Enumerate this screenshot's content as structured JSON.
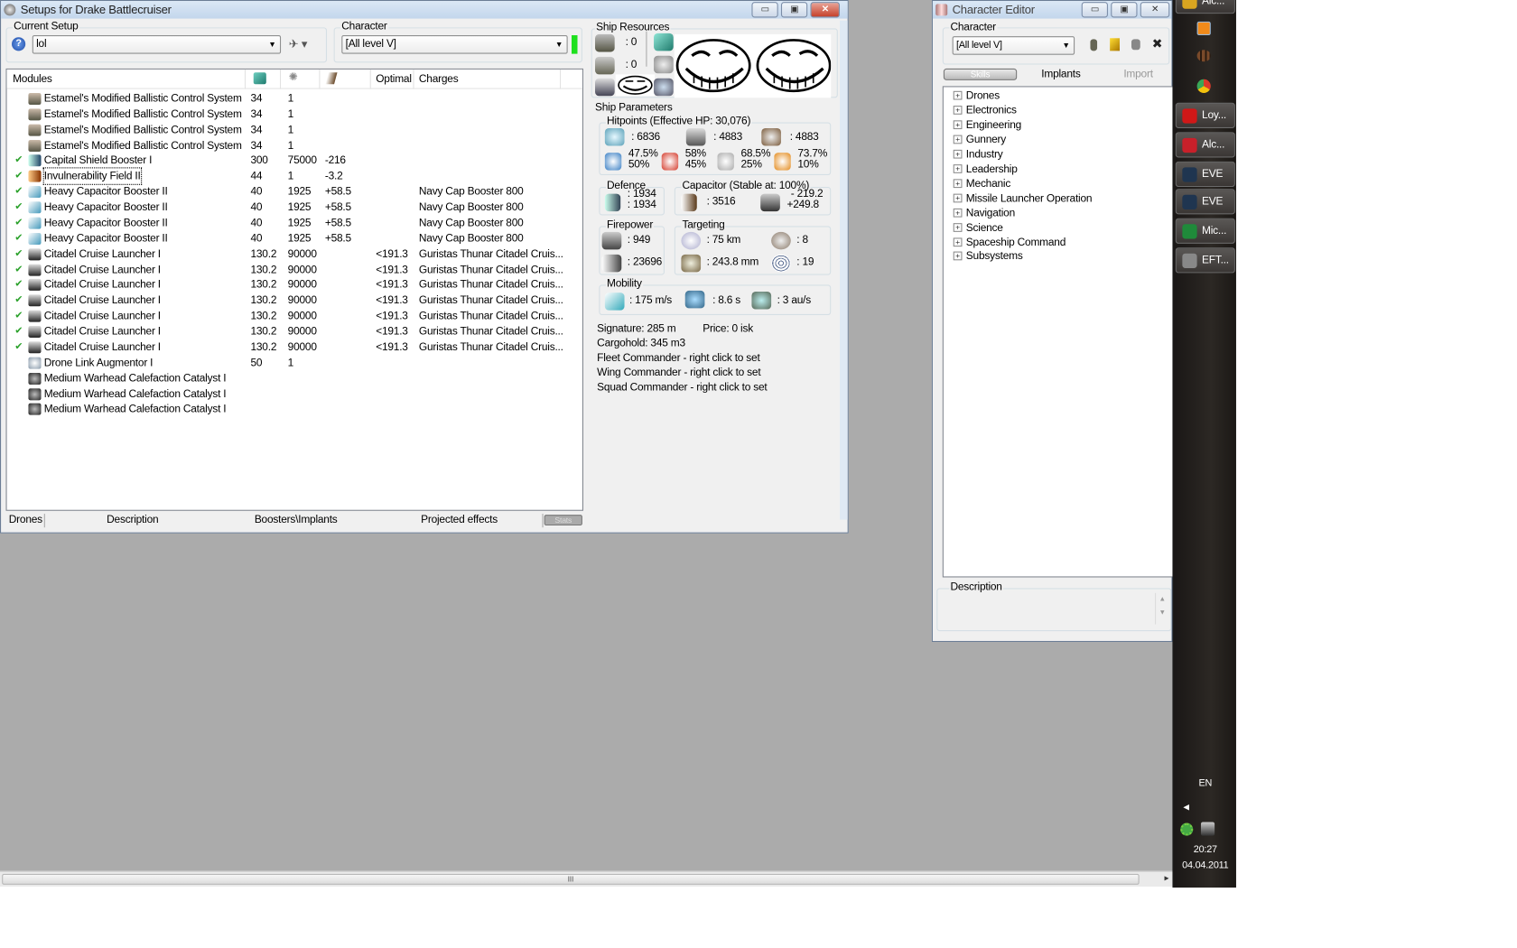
{
  "main_window": {
    "title": "Setups for Drake Battlecruiser",
    "current_setup_label": "Current Setup",
    "current_setup_value": "lol",
    "character_label": "Character",
    "character_value": "[All level V]",
    "modules_header": {
      "name": "Modules",
      "optimal": "Optimal",
      "charges": "Charges"
    },
    "modules": [
      {
        "checked": false,
        "icon": "ballistic-control-icon",
        "name": "Estamel's Modified Ballistic Control System",
        "cpu": "34",
        "pg": "1",
        "cap": "",
        "optimal": "",
        "charges": ""
      },
      {
        "checked": false,
        "icon": "ballistic-control-icon",
        "name": "Estamel's Modified Ballistic Control System",
        "cpu": "34",
        "pg": "1",
        "cap": "",
        "optimal": "",
        "charges": ""
      },
      {
        "checked": false,
        "icon": "ballistic-control-icon",
        "name": "Estamel's Modified Ballistic Control System",
        "cpu": "34",
        "pg": "1",
        "cap": "",
        "optimal": "",
        "charges": ""
      },
      {
        "checked": false,
        "icon": "ballistic-control-icon",
        "name": "Estamel's Modified Ballistic Control System",
        "cpu": "34",
        "pg": "1",
        "cap": "",
        "optimal": "",
        "charges": ""
      },
      {
        "checked": true,
        "icon": "shield-booster-icon",
        "name": "Capital Shield Booster I",
        "cpu": "300",
        "pg": "75000",
        "cap": "-216",
        "optimal": "",
        "charges": ""
      },
      {
        "checked": true,
        "icon": "invulnerability-field-icon",
        "name": "Invulnerability Field II",
        "cpu": "44",
        "pg": "1",
        "cap": "-3.2",
        "optimal": "",
        "charges": ""
      },
      {
        "checked": true,
        "icon": "capacitor-booster-icon",
        "name": "Heavy Capacitor Booster II",
        "cpu": "40",
        "pg": "1925",
        "cap": "+58.5",
        "optimal": "",
        "charges": "Navy Cap Booster 800"
      },
      {
        "checked": true,
        "icon": "capacitor-booster-icon",
        "name": "Heavy Capacitor Booster II",
        "cpu": "40",
        "pg": "1925",
        "cap": "+58.5",
        "optimal": "",
        "charges": "Navy Cap Booster 800"
      },
      {
        "checked": true,
        "icon": "capacitor-booster-icon",
        "name": "Heavy Capacitor Booster II",
        "cpu": "40",
        "pg": "1925",
        "cap": "+58.5",
        "optimal": "",
        "charges": "Navy Cap Booster 800"
      },
      {
        "checked": true,
        "icon": "capacitor-booster-icon",
        "name": "Heavy Capacitor Booster II",
        "cpu": "40",
        "pg": "1925",
        "cap": "+58.5",
        "optimal": "",
        "charges": "Navy Cap Booster 800"
      },
      {
        "checked": true,
        "icon": "missile-launcher-icon",
        "name": "Citadel Cruise Launcher I",
        "cpu": "130.2",
        "pg": "90000",
        "cap": "",
        "optimal": "<191.3",
        "charges": "Guristas Thunar Citadel Cruis..."
      },
      {
        "checked": true,
        "icon": "missile-launcher-icon",
        "name": "Citadel Cruise Launcher I",
        "cpu": "130.2",
        "pg": "90000",
        "cap": "",
        "optimal": "<191.3",
        "charges": "Guristas Thunar Citadel Cruis..."
      },
      {
        "checked": true,
        "icon": "missile-launcher-icon",
        "name": "Citadel Cruise Launcher I",
        "cpu": "130.2",
        "pg": "90000",
        "cap": "",
        "optimal": "<191.3",
        "charges": "Guristas Thunar Citadel Cruis..."
      },
      {
        "checked": true,
        "icon": "missile-launcher-icon",
        "name": "Citadel Cruise Launcher I",
        "cpu": "130.2",
        "pg": "90000",
        "cap": "",
        "optimal": "<191.3",
        "charges": "Guristas Thunar Citadel Cruis..."
      },
      {
        "checked": true,
        "icon": "missile-launcher-icon",
        "name": "Citadel Cruise Launcher I",
        "cpu": "130.2",
        "pg": "90000",
        "cap": "",
        "optimal": "<191.3",
        "charges": "Guristas Thunar Citadel Cruis..."
      },
      {
        "checked": true,
        "icon": "missile-launcher-icon",
        "name": "Citadel Cruise Launcher I",
        "cpu": "130.2",
        "pg": "90000",
        "cap": "",
        "optimal": "<191.3",
        "charges": "Guristas Thunar Citadel Cruis..."
      },
      {
        "checked": true,
        "icon": "missile-launcher-icon",
        "name": "Citadel Cruise Launcher I",
        "cpu": "130.2",
        "pg": "90000",
        "cap": "",
        "optimal": "<191.3",
        "charges": "Guristas Thunar Citadel Cruis..."
      },
      {
        "checked": false,
        "icon": "drone-link-icon",
        "name": "Drone Link Augmentor I",
        "cpu": "50",
        "pg": "1",
        "cap": "",
        "optimal": "",
        "charges": ""
      },
      {
        "checked": false,
        "icon": "rig-icon",
        "name": "Medium Warhead Calefaction Catalyst I",
        "cpu": "",
        "pg": "",
        "cap": "",
        "optimal": "",
        "charges": ""
      },
      {
        "checked": false,
        "icon": "rig-icon",
        "name": "Medium Warhead Calefaction Catalyst I",
        "cpu": "",
        "pg": "",
        "cap": "",
        "optimal": "",
        "charges": ""
      },
      {
        "checked": false,
        "icon": "rig-icon",
        "name": "Medium Warhead Calefaction Catalyst I",
        "cpu": "",
        "pg": "",
        "cap": "",
        "optimal": "",
        "charges": ""
      }
    ],
    "bottom_tabs": [
      "Drones",
      "Description",
      "Boosters\\Implants",
      "Projected effects"
    ],
    "stats_button": "Stats",
    "ship_resources": {
      "label": "Ship Resources",
      "turrets": ": 0",
      "launchers": ": 0"
    },
    "ship_parameters": {
      "label": "Ship Parameters",
      "hitpoints_label": "Hitpoints (Effective HP: 30,076)",
      "shield_hp": ": 6836",
      "armor_hp": ": 4883",
      "structure_hp": ": 4883",
      "resists": [
        {
          "top": "47.5%",
          "bottom": "50%",
          "color": "#3a7fc4"
        },
        {
          "top": "58%",
          "bottom": "45%",
          "color": "#d43a2a"
        },
        {
          "top": "68.5%",
          "bottom": "25%",
          "color": "#aaaaaa"
        },
        {
          "top": "73.7%",
          "bottom": "10%",
          "color": "#e38a1c"
        }
      ],
      "defence_label": "Defence",
      "defence_top": ": 1934",
      "defence_bottom": ": 1934",
      "capacitor_label": "Capacitor (Stable at: 100%)",
      "capacitor_value": ": 3516",
      "cap_use": "- 219.2",
      "cap_recharge": "+249.8",
      "firepower_label": "Firepower",
      "volley": ": 949",
      "dps": ": 23696",
      "targeting_label": "Targeting",
      "target_range": ": 75 km",
      "max_targets": ": 8",
      "scan_res": ": 243.8 mm",
      "sensor_strength": ": 19",
      "mobility_label": "Mobility",
      "velocity": ": 175 m/s",
      "align_time": ": 8.6 s",
      "warp_speed": ": 3 au/s",
      "signature": "Signature: 285 m",
      "price": "Price: 0 isk",
      "cargohold": "Cargohold: 345 m3",
      "fleet_commander": "Fleet Commander - right click to set",
      "wing_commander": "Wing Commander - right click to set",
      "squad_commander": "Squad Commander - right click to set"
    }
  },
  "character_editor": {
    "title": "Character Editor",
    "character_label": "Character",
    "character_value": "[All level V]",
    "tabs": [
      "Skills",
      "Implants",
      "Import"
    ],
    "skill_groups": [
      "Drones",
      "Electronics",
      "Engineering",
      "Gunnery",
      "Industry",
      "Leadership",
      "Mechanic",
      "Missile Launcher Operation",
      "Navigation",
      "Science",
      "Spaceship Command",
      "Subsystems"
    ],
    "description_label": "Description"
  },
  "taskbar": {
    "buttons": [
      {
        "label": "Alc...",
        "color": "#d9a520"
      },
      {
        "label": "Loy...",
        "color": "#d01818"
      },
      {
        "label": "Alc...",
        "color": "#c8202a"
      },
      {
        "label": "EVE",
        "color": "#1f3550"
      },
      {
        "label": "EVE",
        "color": "#1f3550"
      },
      {
        "label": "Mic...",
        "color": "#1f8a3a"
      },
      {
        "label": "EFT...",
        "color": "#888888"
      }
    ],
    "language": "EN",
    "time": "20:27",
    "date": "04.04.2011"
  }
}
